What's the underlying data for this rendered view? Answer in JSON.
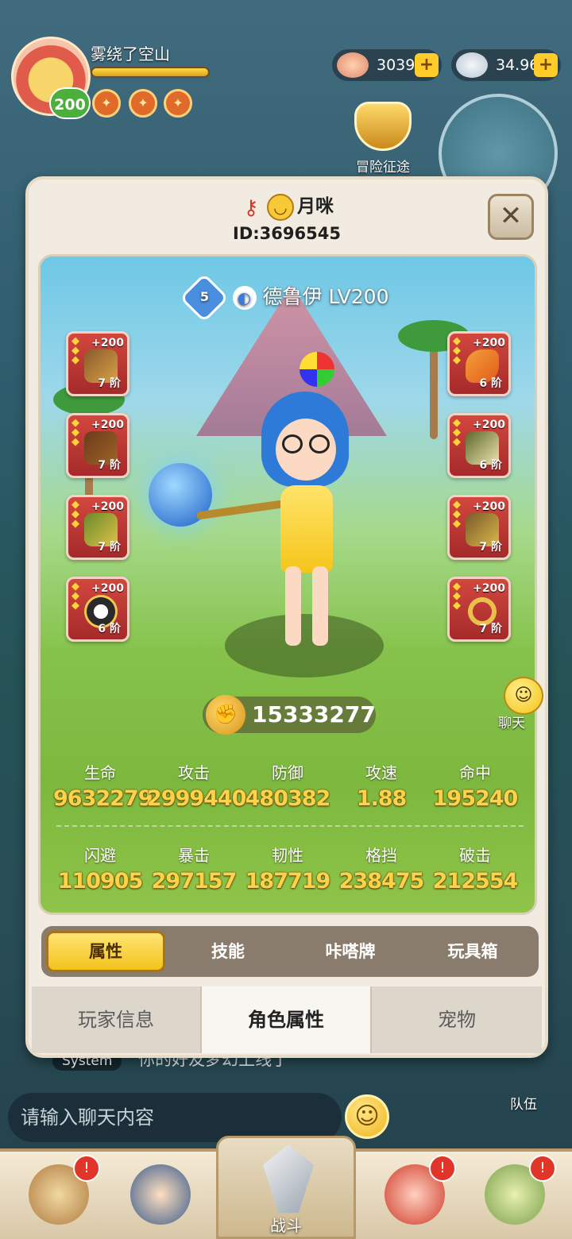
{
  "hud": {
    "player_name": "雾绕了空山",
    "level": "200",
    "exp_fraction": 1.0,
    "currency_shells": "3039",
    "currency_pearls": "34.96M",
    "adventure_label": "冒险征途",
    "icons": [
      "avatar-icon",
      "shell-icon",
      "pearl-icon",
      "plus-icon",
      "trophy-icon"
    ]
  },
  "chat": {
    "system_tag": "System",
    "system_message": "你的好友梦幻上线了",
    "input_placeholder": "请输入聊天内容",
    "team_label": "队伍"
  },
  "bottom_nav": {
    "battle_label": "战斗"
  },
  "profile": {
    "nickname": "月咪",
    "player_id": "ID:3696545",
    "close_glyph": "✕",
    "class_name": "德鲁伊",
    "class_level": "LV200",
    "star_level": "5",
    "power": "15333277",
    "chat_bubble_label": "聊天"
  },
  "equipment": {
    "left": [
      {
        "plus": "+200",
        "tier": "7 阶",
        "icon": "staff-equip-icon"
      },
      {
        "plus": "+200",
        "tier": "7 阶",
        "icon": "branch-equip-icon"
      },
      {
        "plus": "+200",
        "tier": "7 阶",
        "icon": "bracer-equip-icon"
      },
      {
        "plus": "+200",
        "tier": "6 阶",
        "icon": "ring-equip-icon"
      }
    ],
    "right": [
      {
        "plus": "+200",
        "tier": "6 阶",
        "icon": "feather-equip-icon"
      },
      {
        "plus": "+200",
        "tier": "6 阶",
        "icon": "armor-equip-icon"
      },
      {
        "plus": "+200",
        "tier": "7 阶",
        "icon": "boots-equip-icon"
      },
      {
        "plus": "+200",
        "tier": "7 阶",
        "icon": "necklace-equip-icon"
      }
    ]
  },
  "stats": {
    "row1": [
      {
        "label": "生命",
        "value": "9632279"
      },
      {
        "label": "攻击",
        "value": "2999440"
      },
      {
        "label": "防御",
        "value": "480382"
      },
      {
        "label": "攻速",
        "value": "1.88"
      },
      {
        "label": "命中",
        "value": "195240"
      }
    ],
    "row2": [
      {
        "label": "闪避",
        "value": "110905"
      },
      {
        "label": "暴击",
        "value": "297157"
      },
      {
        "label": "韧性",
        "value": "187719"
      },
      {
        "label": "格挡",
        "value": "238475"
      },
      {
        "label": "破击",
        "value": "212554"
      }
    ]
  },
  "sub_tabs": [
    {
      "label": "属性",
      "active": true
    },
    {
      "label": "技能",
      "active": false
    },
    {
      "label": "咔嗒牌",
      "active": false
    },
    {
      "label": "玩具箱",
      "active": false
    }
  ],
  "main_tabs": [
    {
      "label": "玩家信息",
      "active": false
    },
    {
      "label": "角色属性",
      "active": true
    },
    {
      "label": "宠物",
      "active": false
    }
  ],
  "colors": {
    "accent_gold": "#ffd24a",
    "equip_red": "#c23a34",
    "tab_active": "#f3c21b",
    "panel_bg": "#f1ebe1"
  }
}
